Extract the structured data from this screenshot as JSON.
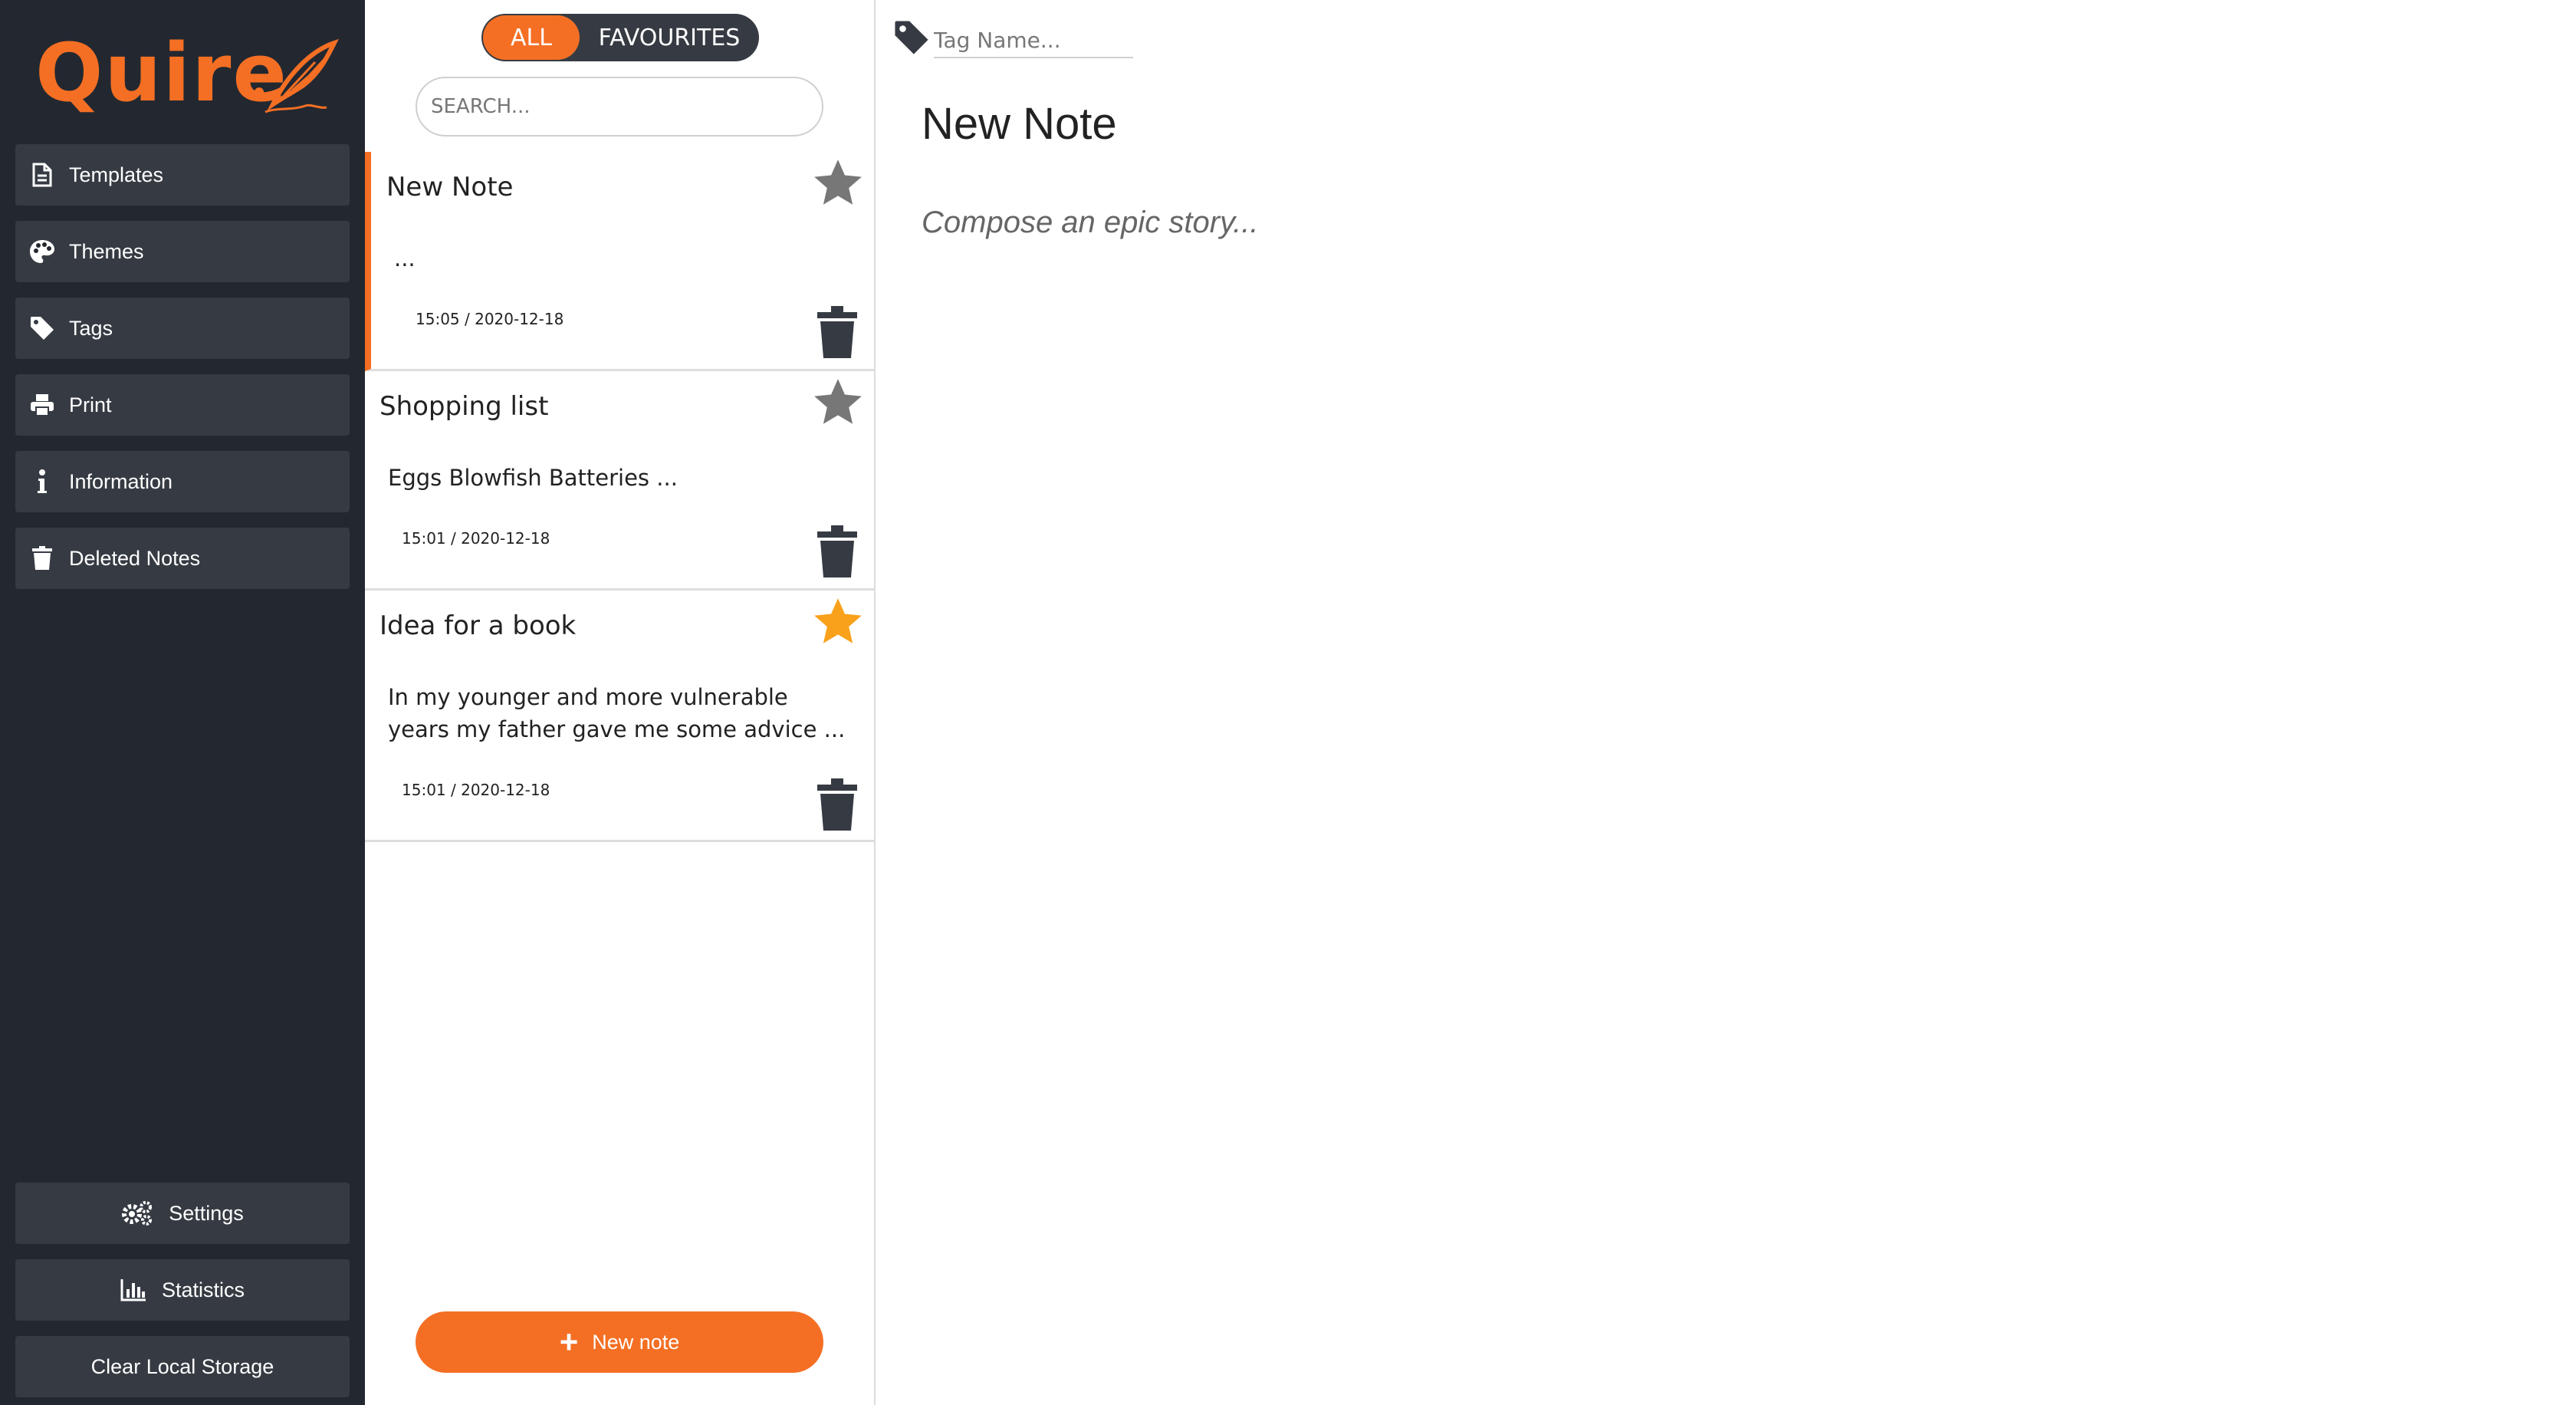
{
  "app": {
    "name": "Quire"
  },
  "colors": {
    "accent": "#f46f24",
    "sidebar": "#232830",
    "sidebar_button": "#363b43",
    "star_active": "#f9a11b",
    "star_inactive": "#777777"
  },
  "sidebar": {
    "items": [
      {
        "label": "Templates",
        "icon": "document-icon"
      },
      {
        "label": "Themes",
        "icon": "palette-icon"
      },
      {
        "label": "Tags",
        "icon": "tag-icon"
      },
      {
        "label": "Print",
        "icon": "printer-icon"
      },
      {
        "label": "Information",
        "icon": "info-icon"
      },
      {
        "label": "Deleted Notes",
        "icon": "trash-icon"
      }
    ],
    "bottom": [
      {
        "label": "Settings",
        "icon": "gears-icon"
      },
      {
        "label": "Statistics",
        "icon": "bar-chart-icon"
      },
      {
        "label": "Clear Local Storage"
      }
    ]
  },
  "list": {
    "filter": {
      "all": "ALL",
      "favourites": "FAVOURITES",
      "selected": "ALL"
    },
    "search": {
      "placeholder": "SEARCH..."
    },
    "notes": [
      {
        "title": "New Note",
        "preview": "...",
        "date": "15:05 / 2020-12-18",
        "favourite": false,
        "active": true
      },
      {
        "title": "Shopping list",
        "preview": "Eggs Blowfish Batteries ...",
        "date": "15:01 / 2020-12-18",
        "favourite": false,
        "active": false
      },
      {
        "title": "Idea for a book",
        "preview": "In my younger and more vulnerable years my father gave me some advice ...",
        "date": "15:01 / 2020-12-18",
        "favourite": true,
        "active": false
      }
    ],
    "new_note_label": "New note"
  },
  "editor": {
    "tag_placeholder": "Tag Name...",
    "title": "New Note",
    "body_placeholder": "Compose an epic story..."
  }
}
